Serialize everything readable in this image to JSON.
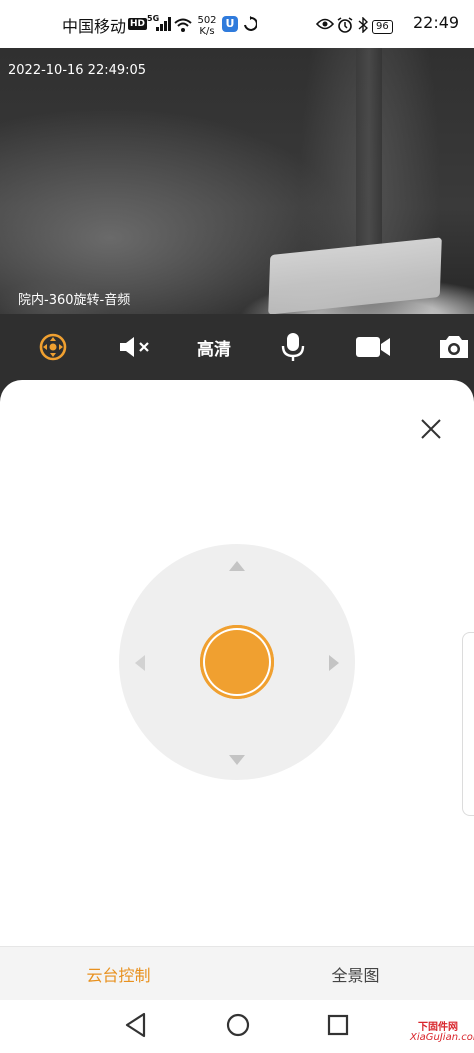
{
  "status_bar": {
    "carrier": "中国移动",
    "hd_badge": "HD",
    "network": "5G",
    "speed_value": "502",
    "speed_unit": "K/s",
    "app_badge": "U",
    "battery": "96",
    "time": "22:49"
  },
  "video": {
    "timestamp": "2022-10-16 22:49:05",
    "camera_name": "院内-360旋转-音频"
  },
  "toolbar": {
    "quality_label": "高清",
    "icons": [
      "ptz-icon",
      "mute-icon",
      "microphone-icon",
      "video-record-icon",
      "snapshot-icon"
    ],
    "accent_color": "#f0a030"
  },
  "panel": {
    "close_icon": "close-icon",
    "joystick_arrows": [
      "up",
      "left",
      "right",
      "down"
    ]
  },
  "tabs": {
    "ptz_label": "云台控制",
    "panorama_label": "全景图",
    "active_color": "#e8911f"
  },
  "navbar": {
    "icons": [
      "back-icon",
      "home-icon",
      "recents-icon"
    ]
  },
  "watermark": {
    "cn": "下固件网",
    "en": "XiaGuJian.com"
  }
}
